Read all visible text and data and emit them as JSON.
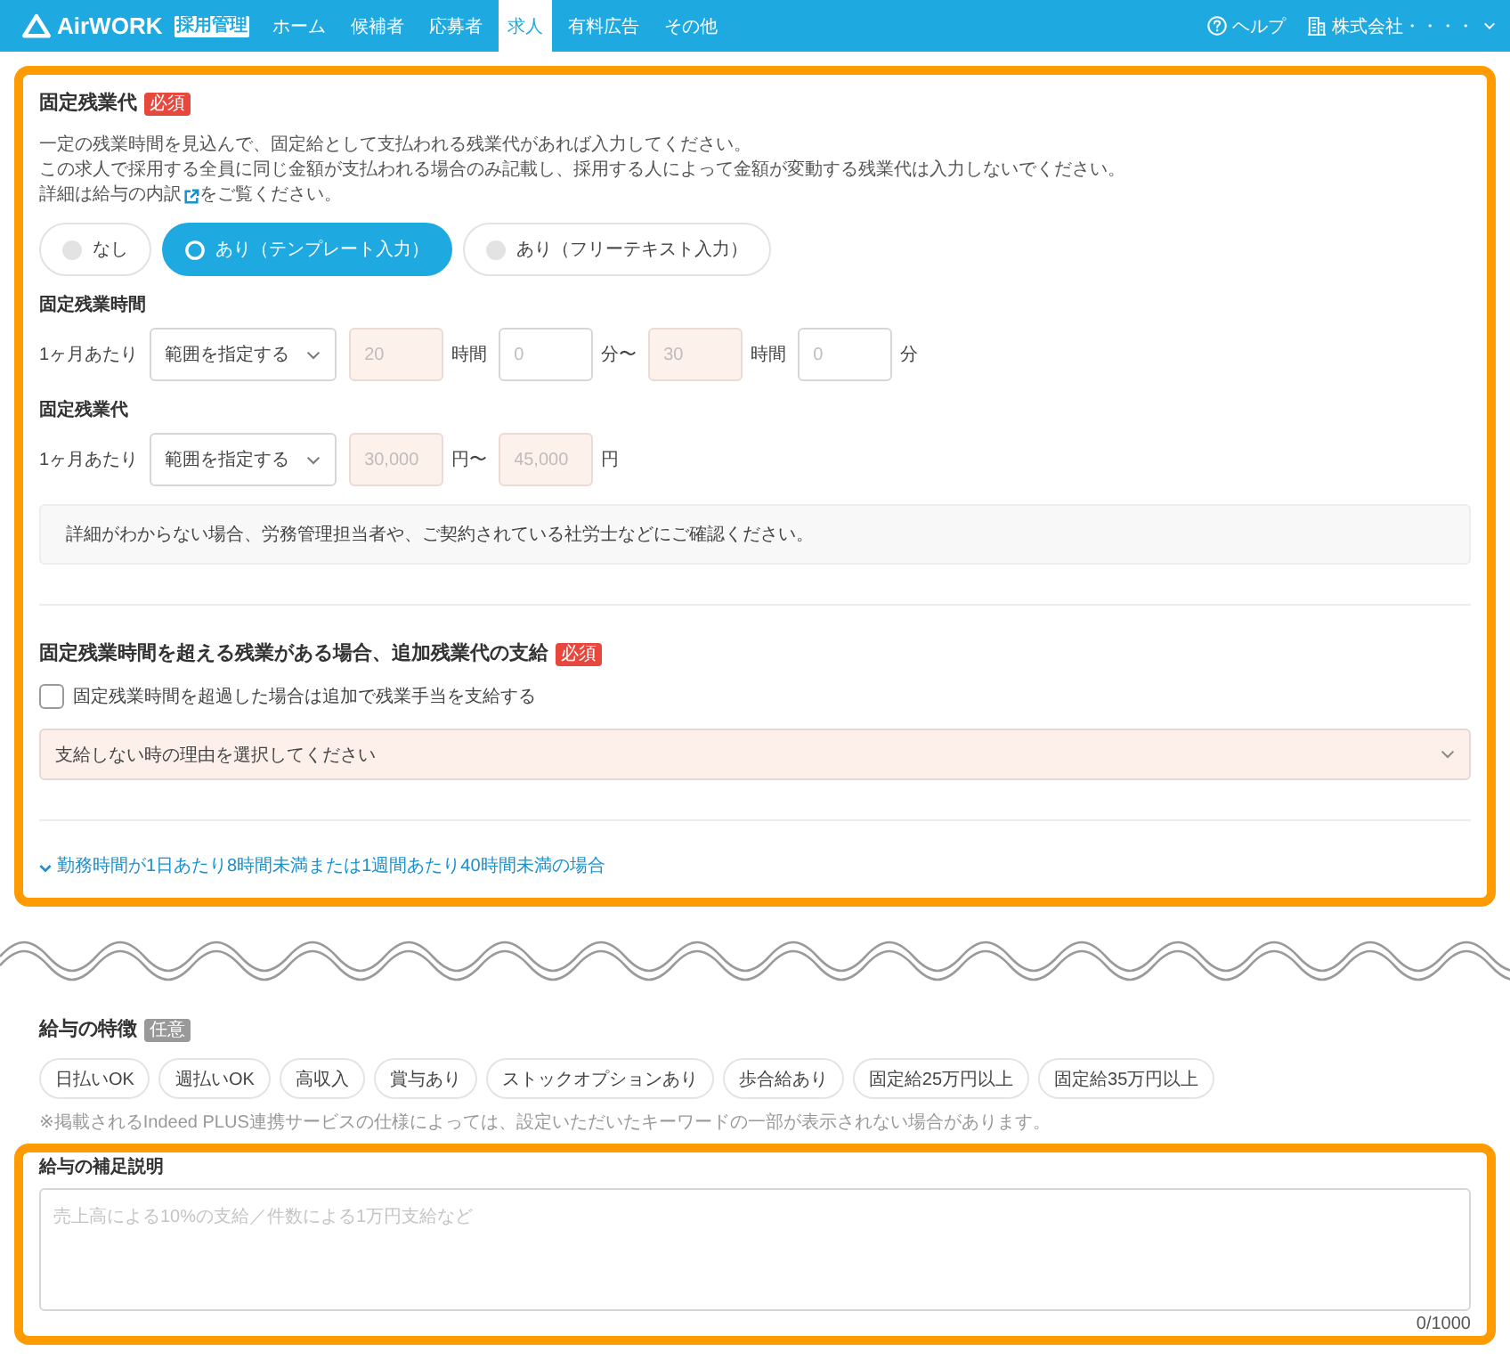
{
  "header": {
    "logo": "AirWORK",
    "product": "採用管理",
    "nav": [
      {
        "label": "ホーム",
        "selected": false
      },
      {
        "label": "候補者",
        "selected": false
      },
      {
        "label": "応募者",
        "selected": false
      },
      {
        "label": "求人",
        "selected": true
      },
      {
        "label": "有料広告",
        "selected": false
      },
      {
        "label": "その他",
        "selected": false
      }
    ],
    "help": "ヘルプ",
    "account": "株式会社・・・・"
  },
  "overtime_panel": {
    "highlighted": true,
    "fixed_overtime": {
      "title": "固定残業代",
      "badge": {
        "label": "必須",
        "kind": "required"
      },
      "description": [
        "一定の残業時間を見込んで、固定給として支払われる残業代があれば入力してください。",
        "この求人で採用する全員に同じ金額が支払われる場合のみ記載し、採用する人によって金額が変動する残業代は入力しないでください。"
      ],
      "detail": {
        "before": "詳細は",
        "link": "給与の内訳",
        "after": "をご覧ください。"
      },
      "options": [
        {
          "label": "なし",
          "selected": false
        },
        {
          "label": "あり（テンプレート入力）",
          "selected": true
        },
        {
          "label": "あり（フリーテキスト入力）",
          "selected": false
        }
      ],
      "rows": [
        {
          "label": "固定残業時間",
          "prefix": "1ヶ月あたり",
          "select": "範囲を指定する",
          "fields": [
            {
              "placeholder": "20",
              "invalid": true,
              "unit": "時間"
            },
            {
              "placeholder": "0",
              "invalid": false,
              "unit": "分〜"
            },
            {
              "placeholder": "30",
              "invalid": true,
              "unit": "時間"
            },
            {
              "placeholder": "0",
              "invalid": false,
              "unit": "分"
            }
          ]
        },
        {
          "label": "固定残業代",
          "prefix": "1ヶ月あたり",
          "select": "範囲を指定する",
          "fields": [
            {
              "placeholder": "30,000",
              "invalid": true,
              "unit": "円〜"
            },
            {
              "placeholder": "45,000",
              "invalid": true,
              "unit": "円"
            }
          ]
        }
      ],
      "info": "詳細がわからない場合、労務管理担当者や、ご契約されている社労士などにご確認ください。"
    },
    "additional_pay": {
      "title": "固定残業時間を超える残業がある場合、追加残業代の支給",
      "badge": {
        "label": "必須",
        "kind": "required"
      },
      "checkbox": {
        "label": "固定残業時間を超過した場合は追加で残業手当を支給する",
        "checked": false
      },
      "reason_select": {
        "value": "支給しない時の理由を選択してください",
        "invalid": true
      },
      "condition_link": {
        "label": "勤務時間が1日あたり8時間未満または1週間あたり40時間未満の場合",
        "expanded": false
      }
    }
  },
  "salary_features": {
    "highlighted": false,
    "title": "給与の特徴",
    "badge": {
      "label": "任意",
      "kind": "optional"
    },
    "tags": [
      {
        "label": "日払いOK",
        "selected": false
      },
      {
        "label": "週払いOK",
        "selected": false
      },
      {
        "label": "高収入",
        "selected": false
      },
      {
        "label": "賞与あり",
        "selected": false
      },
      {
        "label": "ストックオプションあり",
        "selected": false
      },
      {
        "label": "歩合給あり",
        "selected": false
      },
      {
        "label": "固定給25万円以上",
        "selected": false
      },
      {
        "label": "固定給35万円以上",
        "selected": false
      }
    ],
    "note": "※掲載されるIndeed PLUS連携サービスの仕様によっては、設定いただいたキーワードの一部が表示されない場合があります。"
  },
  "salary_supplement": {
    "highlighted": true,
    "title": "給与の補足説明",
    "placeholder": "売上高による10%の支給／件数による1万円支給など",
    "counter": "0/1000"
  }
}
